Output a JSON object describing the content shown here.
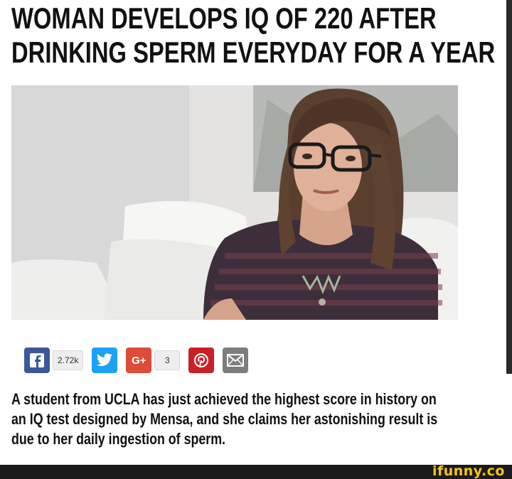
{
  "headline": {
    "line1": "WOMAN DEVELOPS IQ OF 220 AFTER",
    "line2": "DRINKING SPERM EVERYDAY FOR A YEAR"
  },
  "share": {
    "facebook_label": "f",
    "facebook_count": "2.72k",
    "twitter_label": "t",
    "googleplus_label": "G+",
    "googleplus_count": "3",
    "pinterest_label": "P",
    "colors": {
      "facebook": "#3b5998",
      "twitter": "#1da1f2",
      "googleplus": "#dd4b39",
      "pinterest": "#cb2027",
      "email": "#7d7d7d"
    }
  },
  "body": {
    "line1": "A student from UCLA has just achieved the highest score in history on",
    "line2": "an IQ test designed by Mensa, and she claims her astonishing result is",
    "line3": "due to her daily ingestion of sperm."
  },
  "footer": {
    "logo": "ifunny.co"
  }
}
